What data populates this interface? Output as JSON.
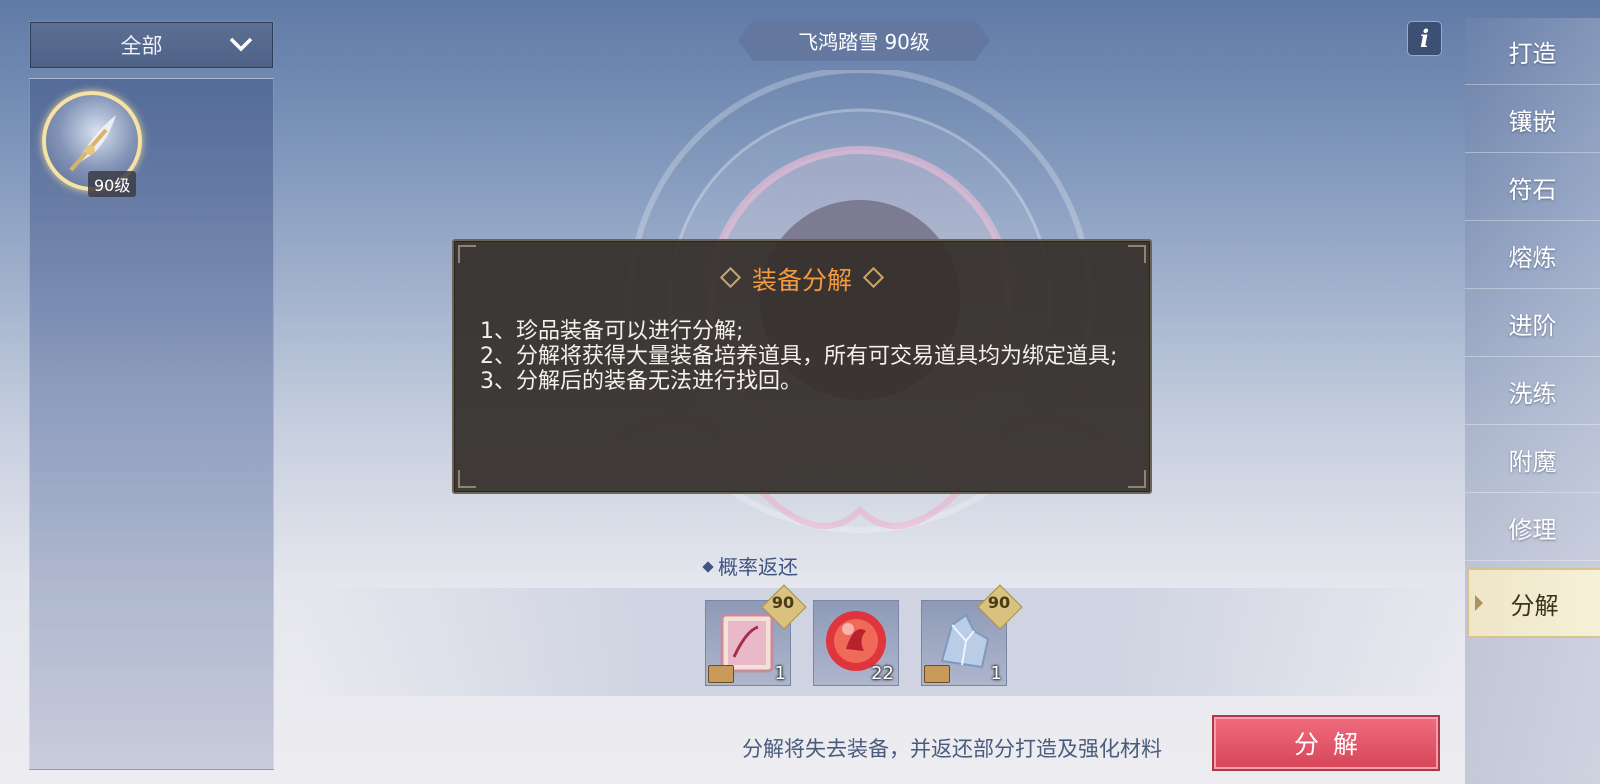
{
  "filter": {
    "label": "全部"
  },
  "item_list": [
    {
      "level": "90级"
    }
  ],
  "top_title": "飞鸿踏雪 90级",
  "info_button": "i",
  "right_nav": {
    "items": [
      "打造",
      "镶嵌",
      "符石",
      "熔炼",
      "进阶",
      "洗练",
      "附魔",
      "修理",
      "分解"
    ],
    "active": "分解"
  },
  "dialog": {
    "title": "装备分解",
    "lines": [
      "1、珍品装备可以进行分解;",
      "2、分解将获得大量装备培养道具，所有可交易道具均为绑定道具;",
      "3、分解后的装备无法进行找回。"
    ]
  },
  "returns": {
    "label": "概率返还",
    "items": [
      {
        "icon": "scroll-icon",
        "level": "90",
        "qty": "1"
      },
      {
        "icon": "red-orb-icon",
        "qty": "22"
      },
      {
        "icon": "crystal-icon",
        "level": "90",
        "qty": "1"
      }
    ]
  },
  "note": "分解将失去装备，并返还部分打造及强化材料",
  "decompose_button": "分解",
  "colors": {
    "accent_orange": "#f19a3e",
    "button_red": "#d8465a",
    "panel_dark": "#342e2a"
  }
}
